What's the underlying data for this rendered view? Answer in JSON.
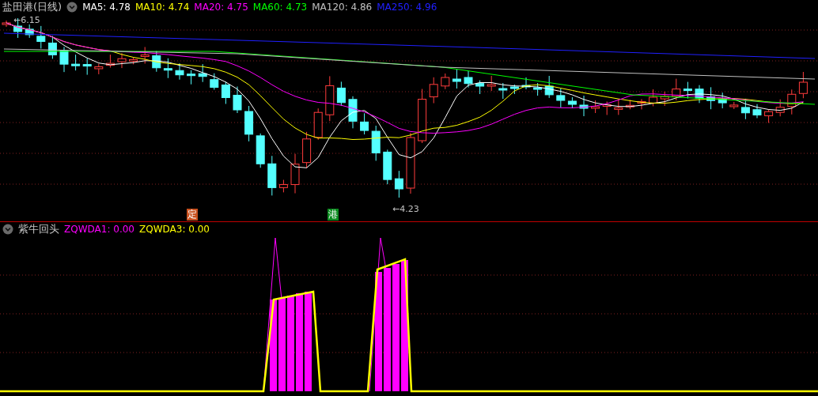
{
  "main_panel": {
    "title": "盐田港(日线)",
    "moving_averages": [
      {
        "label": "MA5: 4.78",
        "color": "#ffffff"
      },
      {
        "label": "MA10: 4.74",
        "color": "#ffff00"
      },
      {
        "label": "MA20: 4.75",
        "color": "#ff00ff"
      },
      {
        "label": "MA60: 4.73",
        "color": "#00ff00"
      },
      {
        "label": "MA120: 4.86",
        "color": "#c0c0c0"
      },
      {
        "label": "MA250: 4.96",
        "color": "#2020ff"
      }
    ],
    "high_label": "←6.15",
    "low_label": "←4.23",
    "markers": [
      {
        "label": "定",
        "color": "#c8501e"
      },
      {
        "label": "港",
        "color": "#0a8a1e"
      }
    ]
  },
  "indicator_panel": {
    "name": "紫牛回头",
    "values": [
      {
        "label": "ZQWDA1: 0.00",
        "color": "#ff00ff"
      },
      {
        "label": "ZQWDA3: 0.00",
        "color": "#ffff00"
      }
    ]
  }
}
